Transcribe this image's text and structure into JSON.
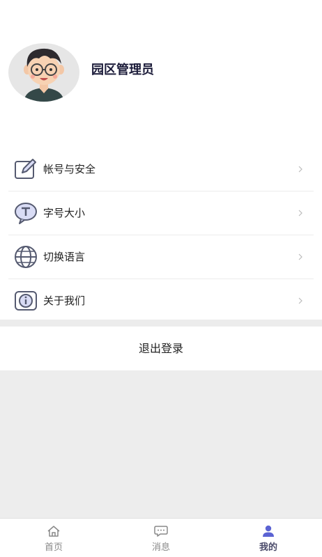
{
  "profile": {
    "name": "园区管理员",
    "avatar": "user-avatar-illustration"
  },
  "menu": {
    "items": [
      {
        "label": "帐号与安全",
        "icon": "edit-icon"
      },
      {
        "label": "字号大小",
        "icon": "font-size-icon"
      },
      {
        "label": "切换语言",
        "icon": "globe-icon"
      },
      {
        "label": "关于我们",
        "icon": "info-icon"
      }
    ]
  },
  "logout_label": "退出登录",
  "tabs": [
    {
      "label": "首页",
      "icon": "home-icon",
      "active": false
    },
    {
      "label": "消息",
      "icon": "message-icon",
      "active": false
    },
    {
      "label": "我的",
      "icon": "user-icon",
      "active": true
    }
  ],
  "colors": {
    "active_tab": "#5b63d3",
    "icon_stroke": "#555a70",
    "divider": "#ececec"
  }
}
